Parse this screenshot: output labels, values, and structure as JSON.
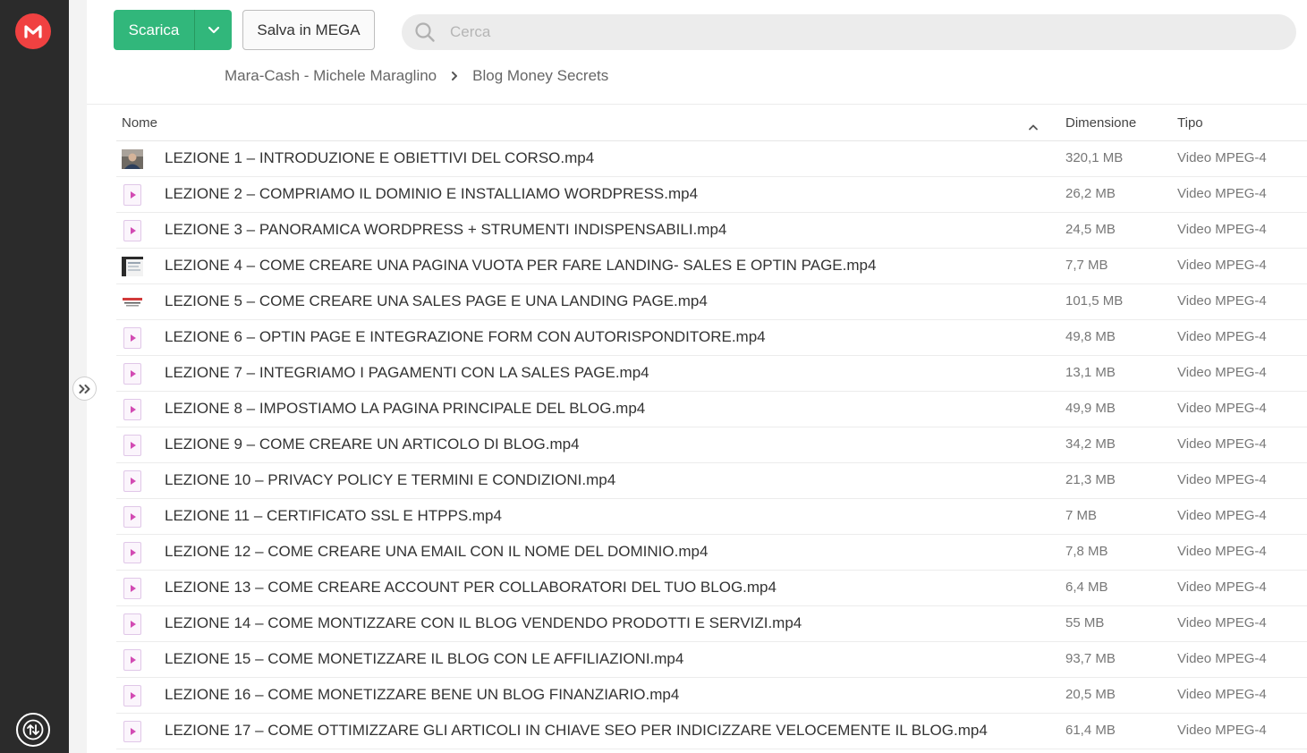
{
  "toolbar": {
    "download_label": "Scarica",
    "save_label": "Salva in MEGA"
  },
  "search": {
    "placeholder": "Cerca"
  },
  "breadcrumb": [
    "Mara-Cash - Michele Maraglino",
    "Blog Money Secrets"
  ],
  "columns": {
    "name": "Nome",
    "size": "Dimensione",
    "type": "Tipo"
  },
  "brand": {
    "accent": "#f04141",
    "green": "#31b77b",
    "video_icon": "#d24bb3"
  },
  "files": [
    {
      "name": "LEZIONE 1 – INTRODUZIONE E OBIETTIVI DEL CORSO.mp4",
      "size": "320,1 MB",
      "type": "Video MPEG-4",
      "icon": "thumbnail-person"
    },
    {
      "name": "LEZIONE 2 – COMPRIAMO IL DOMINIO E INSTALLIAMO WORDPRESS.mp4",
      "size": "26,2 MB",
      "type": "Video MPEG-4",
      "icon": "video-file-icon"
    },
    {
      "name": "LEZIONE 3 – PANORAMICA WORDPRESS + STRUMENTI INDISPENSABILI.mp4",
      "size": "24,5 MB",
      "type": "Video MPEG-4",
      "icon": "video-file-icon"
    },
    {
      "name": "LEZIONE 4 – COME CREARE UNA PAGINA VUOTA PER FARE LANDING- SALES E OPTIN PAGE.mp4",
      "size": "7,7 MB",
      "type": "Video MPEG-4",
      "icon": "thumbnail-screen"
    },
    {
      "name": "LEZIONE 5 – COME CREARE UNA SALES PAGE E UNA LANDING PAGE.mp4",
      "size": "101,5 MB",
      "type": "Video MPEG-4",
      "icon": "thumbnail-page"
    },
    {
      "name": "LEZIONE 6 – OPTIN PAGE E INTEGRAZIONE FORM CON AUTORISPONDITORE.mp4",
      "size": "49,8 MB",
      "type": "Video MPEG-4",
      "icon": "video-file-icon"
    },
    {
      "name": "LEZIONE 7 – INTEGRIAMO I PAGAMENTI CON LA SALES PAGE.mp4",
      "size": "13,1 MB",
      "type": "Video MPEG-4",
      "icon": "video-file-icon"
    },
    {
      "name": "LEZIONE 8 – IMPOSTIAMO LA PAGINA PRINCIPALE DEL BLOG.mp4",
      "size": "49,9 MB",
      "type": "Video MPEG-4",
      "icon": "video-file-icon"
    },
    {
      "name": "LEZIONE 9 – COME CREARE UN ARTICOLO DI BLOG.mp4",
      "size": "34,2 MB",
      "type": "Video MPEG-4",
      "icon": "video-file-icon"
    },
    {
      "name": "LEZIONE 10 – PRIVACY POLICY E TERMINI E CONDIZIONI.mp4",
      "size": "21,3 MB",
      "type": "Video MPEG-4",
      "icon": "video-file-icon"
    },
    {
      "name": "LEZIONE 11 – CERTIFICATO SSL E HTPPS.mp4",
      "size": "7 MB",
      "type": "Video MPEG-4",
      "icon": "video-file-icon"
    },
    {
      "name": "LEZIONE 12 – COME CREARE UNA EMAIL CON IL NOME DEL DOMINIO.mp4",
      "size": "7,8 MB",
      "type": "Video MPEG-4",
      "icon": "video-file-icon"
    },
    {
      "name": "LEZIONE 13 – COME CREARE ACCOUNT PER COLLABORATORI DEL TUO BLOG.mp4",
      "size": "6,4 MB",
      "type": "Video MPEG-4",
      "icon": "video-file-icon"
    },
    {
      "name": "LEZIONE 14 – COME MONTIZZARE CON IL BLOG VENDENDO PRODOTTI E SERVIZI.mp4",
      "size": "55 MB",
      "type": "Video MPEG-4",
      "icon": "video-file-icon"
    },
    {
      "name": "LEZIONE 15 – COME MONETIZZARE IL BLOG CON LE AFFILIAZIONI.mp4",
      "size": "93,7 MB",
      "type": "Video MPEG-4",
      "icon": "video-file-icon"
    },
    {
      "name": "LEZIONE 16 – COME MONETIZZARE BENE UN BLOG FINANZIARIO.mp4",
      "size": "20,5 MB",
      "type": "Video MPEG-4",
      "icon": "video-file-icon"
    },
    {
      "name": "LEZIONE 17 – COME OTTIMIZZARE GLI ARTICOLI IN CHIAVE SEO PER INDICIZZARE VELOCEMENTE IL BLOG.mp4",
      "size": "61,4 MB",
      "type": "Video MPEG-4",
      "icon": "video-file-icon"
    }
  ]
}
